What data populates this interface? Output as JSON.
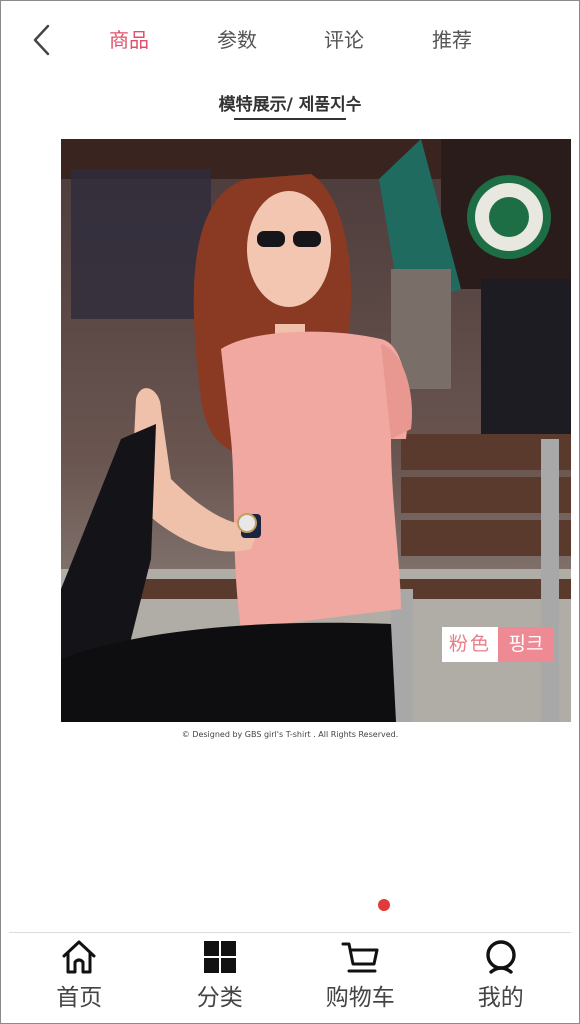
{
  "header": {
    "tabs": [
      {
        "label": "商品",
        "active": true
      },
      {
        "label": "参数",
        "active": false
      },
      {
        "label": "评论",
        "active": false
      },
      {
        "label": "推荐",
        "active": false
      }
    ]
  },
  "section": {
    "title": "模特展示/ 제품지수"
  },
  "product_image": {
    "color_tag_cn": "粉色",
    "color_tag_kr": "핑크",
    "credit": "© Designed by GBS girl's T-shirt . All Rights Reserved."
  },
  "carousel": {
    "active_index": 0,
    "dot_color": "#e03a3a"
  },
  "bottom_nav": {
    "items": [
      {
        "label": "首页",
        "icon": "home-icon"
      },
      {
        "label": "分类",
        "icon": "grid-icon"
      },
      {
        "label": "购物车",
        "icon": "cart-icon"
      },
      {
        "label": "我的",
        "icon": "user-icon"
      }
    ]
  },
  "colors": {
    "accent": "#e0506a",
    "tag_pink": "#ef8a94"
  }
}
